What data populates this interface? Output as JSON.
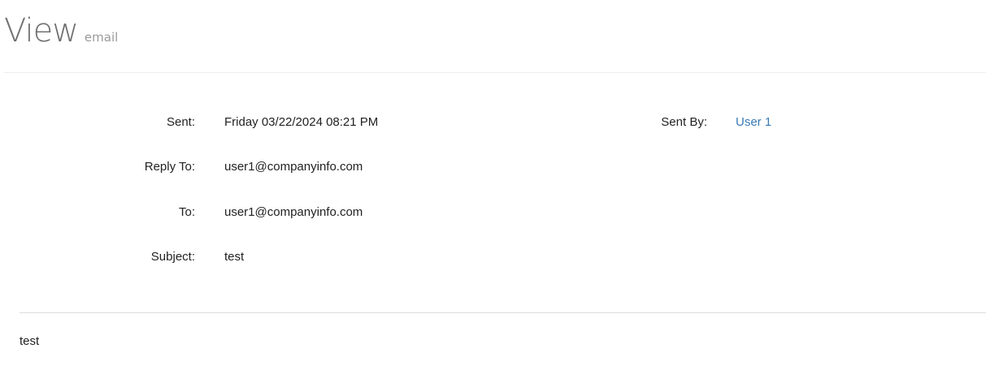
{
  "header": {
    "title": "View",
    "subtitle": "email"
  },
  "email": {
    "fields": [
      {
        "label": "Sent:",
        "value": "Friday 03/22/2024 08:21 PM"
      },
      {
        "label": "Reply To:",
        "value": "user1@companyinfo.com"
      },
      {
        "label": "To:",
        "value": "user1@companyinfo.com"
      },
      {
        "label": "Subject:",
        "value": "test"
      }
    ],
    "sent_by": {
      "label": "Sent By:",
      "value": "User 1"
    },
    "body": "test"
  },
  "colors": {
    "link": "#3a7ab5",
    "title": "#707070"
  }
}
